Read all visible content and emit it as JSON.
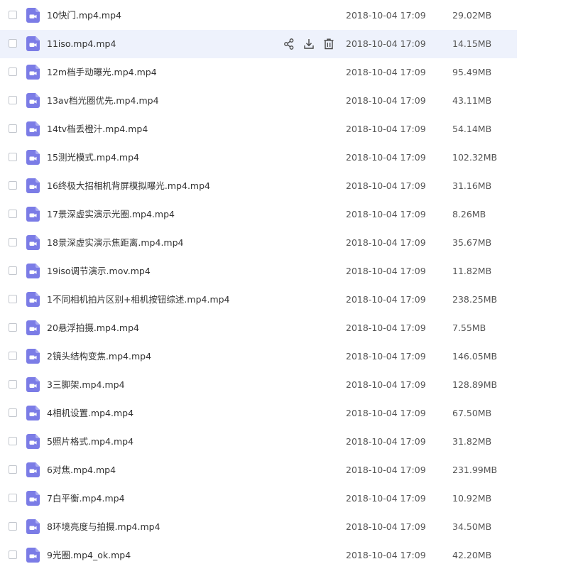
{
  "colors": {
    "accent": "#7b7ce6",
    "hover_row": "#eef2fc",
    "text": "#333333"
  },
  "row_actions": {
    "share_icon": "share-icon",
    "download_icon": "download-icon",
    "delete_icon": "trash-icon"
  },
  "files": [
    {
      "name": "10快门.mp4.mp4",
      "date": "2018-10-04 17:09",
      "size": "29.02MB"
    },
    {
      "name": "11iso.mp4.mp4",
      "date": "2018-10-04 17:09",
      "size": "14.15MB",
      "hovered": true
    },
    {
      "name": "12m档手动曝光.mp4.mp4",
      "date": "2018-10-04 17:09",
      "size": "95.49MB"
    },
    {
      "name": "13av档光圈优先.mp4.mp4",
      "date": "2018-10-04 17:09",
      "size": "43.11MB"
    },
    {
      "name": "14tv档丢橙汁.mp4.mp4",
      "date": "2018-10-04 17:09",
      "size": "54.14MB"
    },
    {
      "name": "15测光模式.mp4.mp4",
      "date": "2018-10-04 17:09",
      "size": "102.32MB"
    },
    {
      "name": "16终极大招相机背屏模拟曝光.mp4.mp4",
      "date": "2018-10-04 17:09",
      "size": "31.16MB"
    },
    {
      "name": "17景深虚实演示光圈.mp4.mp4",
      "date": "2018-10-04 17:09",
      "size": "8.26MB"
    },
    {
      "name": "18景深虚实演示焦距离.mp4.mp4",
      "date": "2018-10-04 17:09",
      "size": "35.67MB"
    },
    {
      "name": "19iso调节演示.mov.mp4",
      "date": "2018-10-04 17:09",
      "size": "11.82MB"
    },
    {
      "name": "1不同相机拍片区别+相机按钮综述.mp4.mp4",
      "date": "2018-10-04 17:09",
      "size": "238.25MB"
    },
    {
      "name": "20悬浮拍摄.mp4.mp4",
      "date": "2018-10-04 17:09",
      "size": "7.55MB"
    },
    {
      "name": "2镜头结构变焦.mp4.mp4",
      "date": "2018-10-04 17:09",
      "size": "146.05MB"
    },
    {
      "name": "3三脚架.mp4.mp4",
      "date": "2018-10-04 17:09",
      "size": "128.89MB"
    },
    {
      "name": "4相机设置.mp4.mp4",
      "date": "2018-10-04 17:09",
      "size": "67.50MB"
    },
    {
      "name": "5照片格式.mp4.mp4",
      "date": "2018-10-04 17:09",
      "size": "31.82MB"
    },
    {
      "name": "6对焦.mp4.mp4",
      "date": "2018-10-04 17:09",
      "size": "231.99MB"
    },
    {
      "name": "7白平衡.mp4.mp4",
      "date": "2018-10-04 17:09",
      "size": "10.92MB"
    },
    {
      "name": "8环境亮度与拍摄.mp4.mp4",
      "date": "2018-10-04 17:09",
      "size": "34.50MB"
    },
    {
      "name": "9光圈.mp4_ok.mp4",
      "date": "2018-10-04 17:09",
      "size": "42.20MB"
    }
  ]
}
